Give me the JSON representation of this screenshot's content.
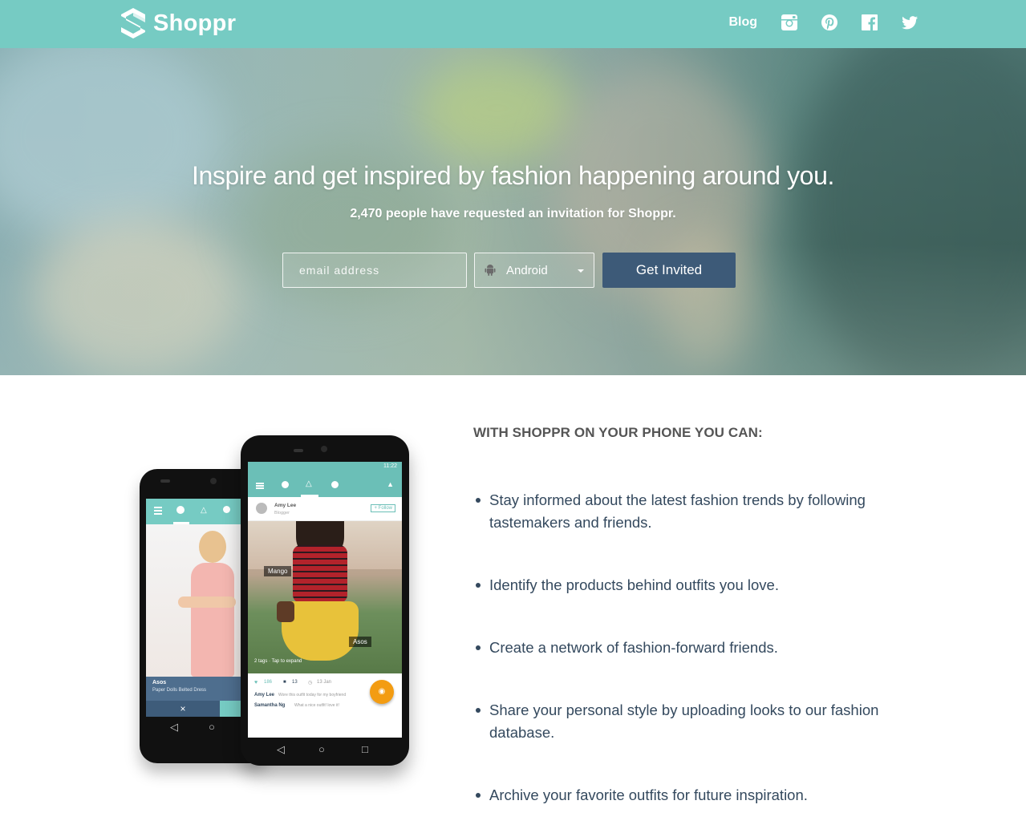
{
  "header": {
    "brand": "Shoppr",
    "nav": {
      "blog": "Blog",
      "icons": [
        "instagram-icon",
        "pinterest-icon",
        "facebook-icon",
        "twitter-icon"
      ]
    }
  },
  "hero": {
    "headline": "Inspire and get inspired by fashion happening around you.",
    "count_text": "2,470 people have requested an invitation for Shoppr.",
    "email_placeholder": "email address",
    "platform": {
      "selected": "Android",
      "icon": "android-icon"
    },
    "cta_label": "Get Invited"
  },
  "features": {
    "title": "WITH SHOPPR ON YOUR PHONE YOU CAN:",
    "items": [
      "Stay informed about the latest fashion trends by following tastemakers and friends.",
      "Identify the products behind outfits you love.",
      "Create a network of fashion-forward friends.",
      "Share your personal style by uploading looks to our fashion database.",
      "Archive your favorite outfits for future inspiration."
    ]
  },
  "phone_back": {
    "product_brand": "Asos",
    "product_name": "Paper Dolls Belted Dress",
    "close_glyph": "×"
  },
  "phone_front": {
    "status_time": "11:22",
    "user_name": "Amy Lee",
    "user_role": "Blogger",
    "follow_label": "+ Follow",
    "tag_1": "Mango",
    "tag_2": "Asos",
    "tags_hint": "2 tags · Tap to expand",
    "likes": "186",
    "comments": "13",
    "date": "13 Jan",
    "comment_1_author": "Amy Lee",
    "comment_1_text": "Wore this outfit today for my boyfriend",
    "comment_2_author": "Samantha Ng",
    "comment_2_text": "What a nice outfit! love it!"
  },
  "colors": {
    "header_bg": "#76cbc3",
    "cta_bg": "#3d5a78",
    "text": "#34495e",
    "title_text": "#555555",
    "camera_fab": "#f39c12"
  }
}
